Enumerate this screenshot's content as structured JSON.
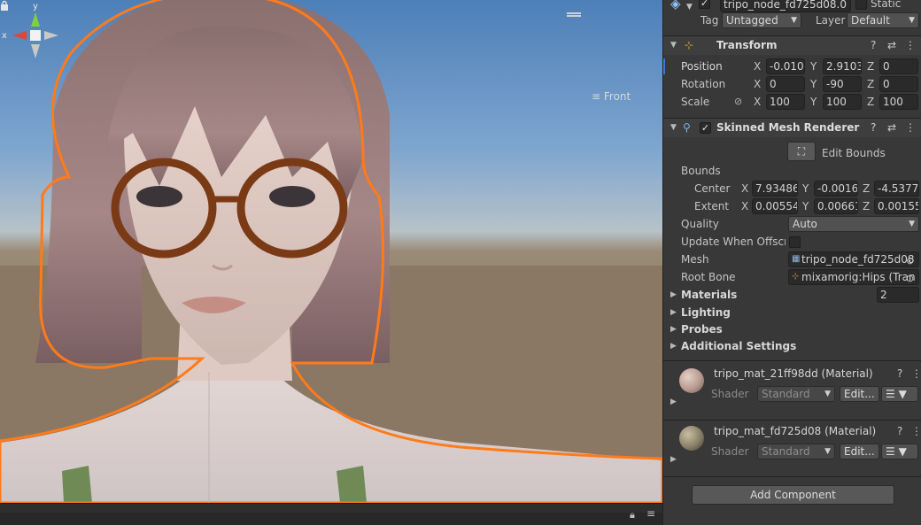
{
  "colors": {
    "selection_outline": "#ff7a1a",
    "inspector_bg": "#383838",
    "field_bg": "#2a2a2a",
    "accent_blue": "#3a79d8"
  },
  "scene": {
    "gizmo": {
      "y_label": "y",
      "x_label": "x",
      "view_label": "Front",
      "view_icon": "hamburger-icon"
    }
  },
  "object": {
    "name": "tripo_node_fd725d08.0",
    "static_label": "Static",
    "tag_label": "Tag",
    "tag_value": "Untagged",
    "layer_label": "Layer",
    "layer_value": "Default"
  },
  "transform": {
    "title": "Transform",
    "position_label": "Position",
    "rotation_label": "Rotation",
    "scale_label": "Scale",
    "axis_x": "X",
    "axis_y": "Y",
    "axis_z": "Z",
    "position": {
      "x": "-0.010",
      "y": "2.9103",
      "z": "0"
    },
    "rotation": {
      "x": "0",
      "y": "-90",
      "z": "0"
    },
    "scale": {
      "x": "100",
      "y": "100",
      "z": "100"
    }
  },
  "smr": {
    "title": "Skinned Mesh Renderer",
    "edit_bounds": "Edit Bounds",
    "bounds_label": "Bounds",
    "center_label": "Center",
    "extent_label": "Extent",
    "center": {
      "x": "7.93486",
      "y": "-0.0016",
      "z": "-4.5377"
    },
    "extent": {
      "x": "0.00554",
      "y": "0.00661",
      "z": "0.00155"
    },
    "quality_label": "Quality",
    "quality_value": "Auto",
    "update_offscreen_label": "Update When Offscre",
    "mesh_label": "Mesh",
    "mesh_value": "tripo_node_fd725d08",
    "root_bone_label": "Root Bone",
    "root_bone_value": "mixamorig:Hips (Tran",
    "materials_label": "Materials",
    "materials_count": "2",
    "lighting_label": "Lighting",
    "probes_label": "Probes",
    "additional_label": "Additional Settings"
  },
  "materials": [
    {
      "name": "tripo_mat_21ff98dd (Material)",
      "shader_label": "Shader",
      "shader_value": "Standard",
      "edit_label": "Edit...",
      "thumb_color": "#b89a90"
    },
    {
      "name": "tripo_mat_fd725d08 (Material)",
      "shader_label": "Shader",
      "shader_value": "Standard",
      "edit_label": "Edit...",
      "thumb_color": "#8a8068"
    }
  ],
  "add_component": "Add Component"
}
